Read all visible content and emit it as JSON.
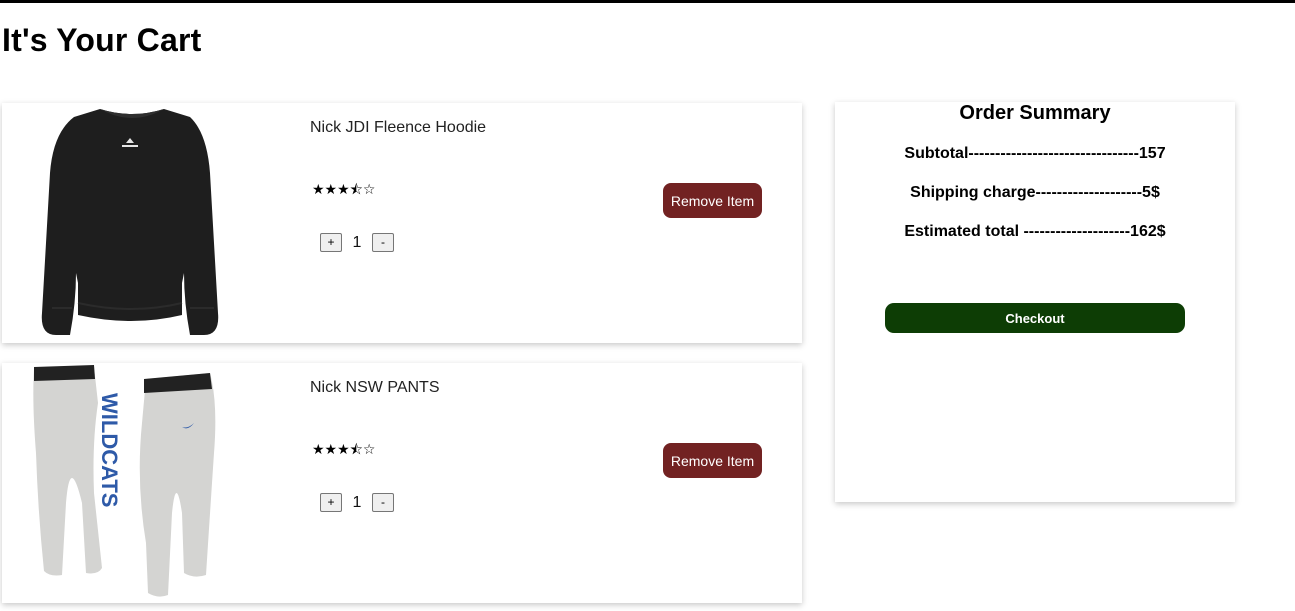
{
  "page": {
    "title": "It's Your Cart"
  },
  "cart": {
    "items": [
      {
        "name": "Nick JDI Fleence Hoodie",
        "rating_text": "★★★⯪☆",
        "rating": 3.5,
        "quantity": "1",
        "remove_label": "Remove Item",
        "plus_label": "+",
        "minus_label": "-",
        "image_icon": "hoodie-image"
      },
      {
        "name": "Nick NSW PANTS",
        "rating_text": "★★★⯪☆",
        "rating": 3.5,
        "quantity": "1",
        "remove_label": "Remove Item",
        "plus_label": "+",
        "minus_label": "-",
        "image_icon": "pants-image",
        "image_text": "WILDCATS"
      }
    ]
  },
  "summary": {
    "title": "Order Summary",
    "subtotal": "Subtotal--------------------------------157",
    "shipping": "Shipping charge--------------------5$",
    "total": "Estimated total --------------------162$",
    "checkout_label": "Checkout"
  },
  "colors": {
    "remove_button": "#722222",
    "checkout_button": "#0d3d05",
    "hoodie": "#1e1e1e",
    "pants": "#d4d4d2",
    "pants_letters": "#2e5aa8"
  }
}
